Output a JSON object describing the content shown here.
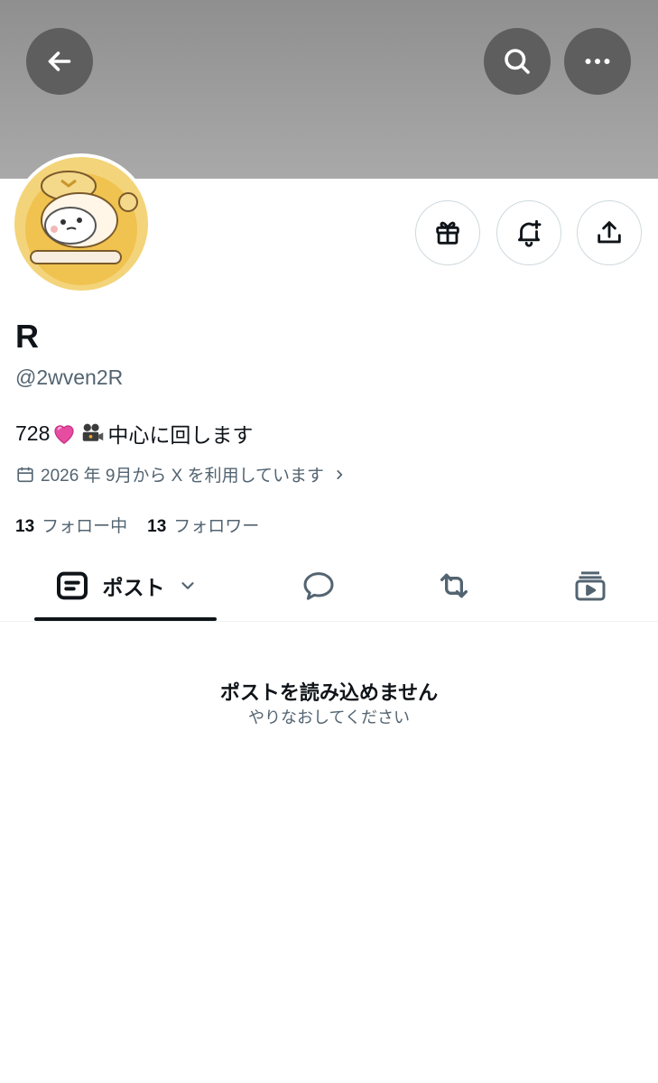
{
  "colors": {
    "banner": "#a0a0a0",
    "text_primary": "#0f1419",
    "text_secondary": "#536471",
    "border": "#cfd9de"
  },
  "header": {
    "back_icon": "arrow-left-icon",
    "search_icon": "search-icon",
    "more_icon": "more-horizontal-icon"
  },
  "profile": {
    "display_name": "R",
    "handle": "@2wven2R",
    "bio_prefix": "728",
    "bio_emojis": [
      "pink-heart",
      "movie-camera"
    ],
    "bio_suffix": "中心に回します",
    "joined": "2026 年 9月から X を利用しています",
    "stats": [
      {
        "count": "13",
        "label": "フォロー中"
      },
      {
        "count": "13",
        "label": "フォロワー"
      }
    ],
    "actions": [
      "gift-icon",
      "bell-plus-icon",
      "share-icon"
    ]
  },
  "tabs": {
    "posts_label": "ポスト",
    "items": [
      "posts-icon",
      "replies-icon",
      "reposts-icon",
      "media-icon"
    ]
  },
  "feed": {
    "error_title": "ポストを読み込めません",
    "error_subtitle": "やりなおしてください"
  }
}
